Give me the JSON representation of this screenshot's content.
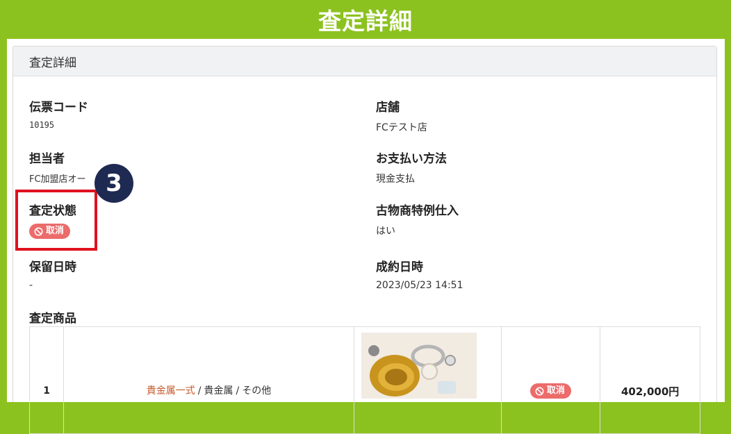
{
  "banner": {
    "title": "査定詳細"
  },
  "card": {
    "header": "査定詳細"
  },
  "fields": {
    "slip_code": {
      "label": "伝票コード",
      "value": "10195"
    },
    "store": {
      "label": "店舗",
      "value": "FCテスト店"
    },
    "staff": {
      "label": "担当者",
      "value": "FC加盟店オー"
    },
    "payment": {
      "label": "お支払い方法",
      "value": "現金支払"
    },
    "status": {
      "label": "査定状態",
      "badge": "取消",
      "badge_icon": "prohibited-icon"
    },
    "antique": {
      "label": "古物商特例仕入",
      "value": "はい"
    },
    "hold_date": {
      "label": "保留日時",
      "value": "-"
    },
    "contract_date": {
      "label": "成約日時",
      "value": "2023/05/23 14:51"
    }
  },
  "step_marker": "3",
  "items_section": {
    "label": "査定商品",
    "rows": [
      {
        "no": "1",
        "category_link": "貴金属一式",
        "category": "貴金属",
        "subcategory": "その他",
        "status_badge": "取消",
        "price": "402,000円"
      }
    ]
  },
  "colors": {
    "frame": "#8cc21f",
    "badge": "#ec6b6b",
    "highlight": "#e0101e",
    "step_circle": "#1f2a52",
    "link": "#c65a2b"
  }
}
